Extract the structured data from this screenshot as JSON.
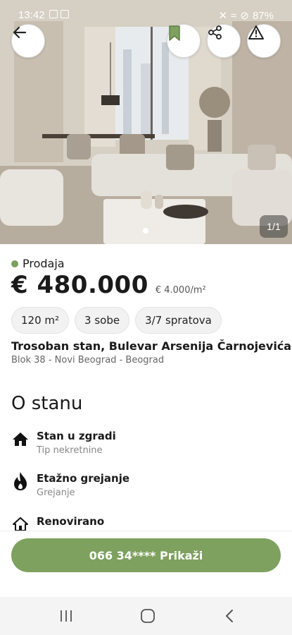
{
  "status_bar": {
    "time": "13:42",
    "battery": "87%",
    "icons_left": [
      "image-icon",
      "message-icon"
    ],
    "icons_right": [
      "mute-icon",
      "wifi-icon",
      "alarm-icon"
    ]
  },
  "hero": {
    "photo_counter": "1/1",
    "buttons": [
      "back-arrow-icon",
      "bookmark-icon",
      "share-icon",
      "report-warning-icon"
    ]
  },
  "listing": {
    "status": "Prodaja",
    "status_color": "#7a9e5b",
    "price": "€ 480.000",
    "price_per_sqm": "€ 4.000/m²",
    "chips": [
      "120 m²",
      "3 sobe",
      "3/7 spratova"
    ],
    "title": "Trosoban stan, Bulevar Arsenija Čarnojevića",
    "location": "Blok 38 - Novi Beograd - Beograd"
  },
  "about": {
    "section_title": "O stanu",
    "features": [
      {
        "name": "Stan u zgradi",
        "label": "Tip nekretnine",
        "icon": "house-icon"
      },
      {
        "name": "Etažno grejanje",
        "label": "Grejanje",
        "icon": "flame-icon"
      },
      {
        "name": "Renovirano",
        "label": "",
        "icon": "house-outline-icon"
      }
    ]
  },
  "cta": {
    "phone_label": "066 34**** Prikaži",
    "color": "#7ea15f"
  },
  "nav": {
    "items": [
      "recent-apps-icon",
      "home-icon",
      "back-icon"
    ]
  }
}
